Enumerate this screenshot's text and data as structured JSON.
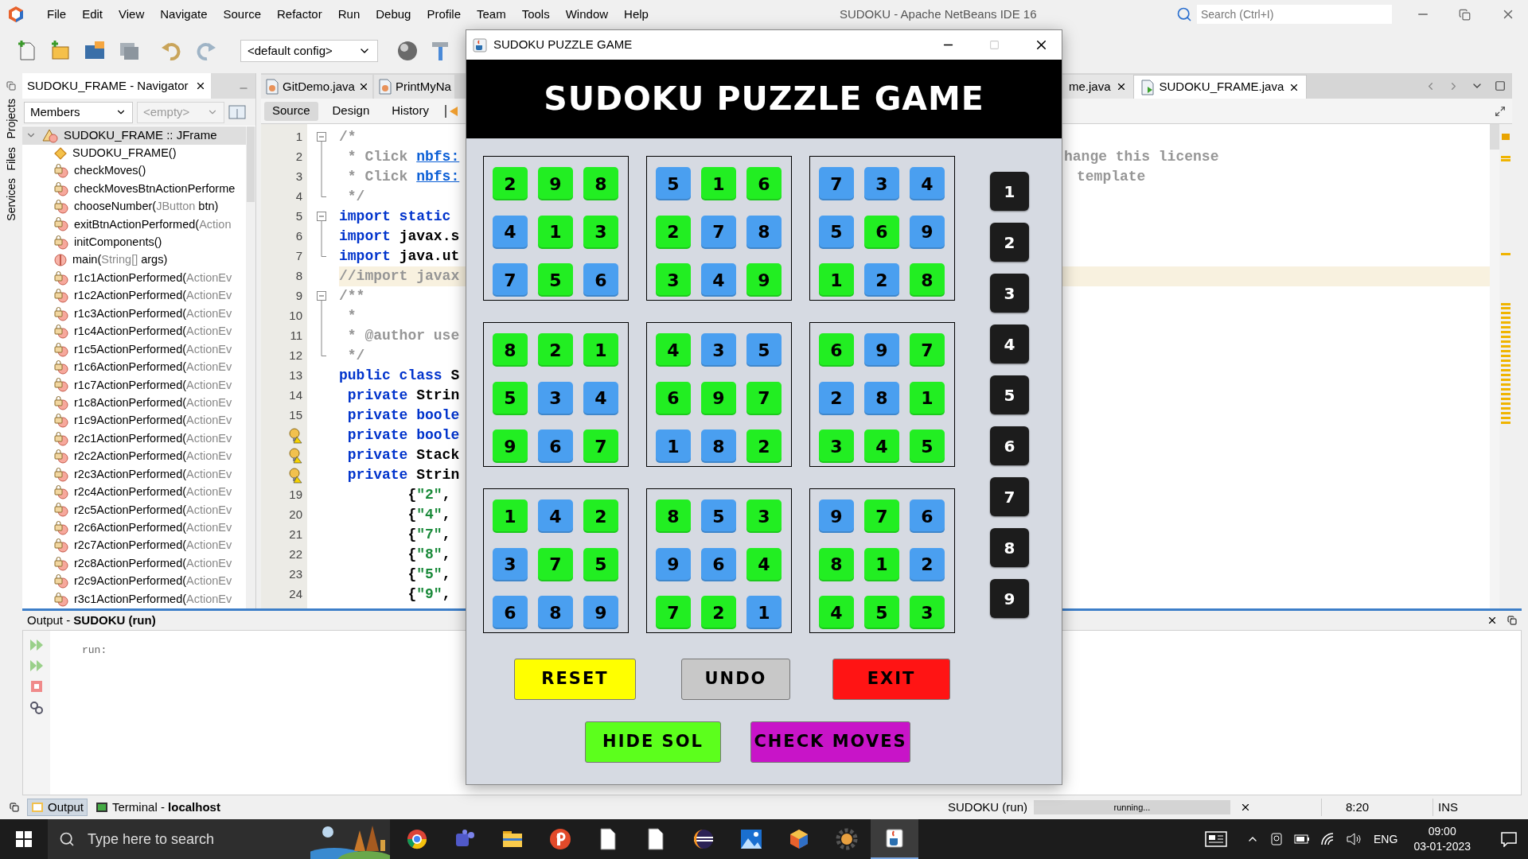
{
  "ide": {
    "title": "SUDOKU - Apache NetBeans IDE 16",
    "search": {
      "placeholder": "Search (Ctrl+I)"
    },
    "menu": [
      "File",
      "Edit",
      "View",
      "Navigate",
      "Source",
      "Refactor",
      "Run",
      "Debug",
      "Profile",
      "Team",
      "Tools",
      "Window",
      "Help"
    ],
    "config": "<default config>"
  },
  "side_tabs": [
    "Projects",
    "Files",
    "Services"
  ],
  "navigator": {
    "title": "SUDOKU_FRAME - Navigator",
    "filter": "Members",
    "filter_2": "<empty>",
    "root": {
      "label": "SUDOKU_FRAME :: JFrame",
      "expanded": true,
      "selected": true,
      "children": [
        {
          "kind": "constructor",
          "name": "SUDOKU_FRAME()",
          "selected": false
        },
        {
          "kind": "method",
          "name": "checkMoves()",
          "selected": false
        },
        {
          "kind": "method",
          "name": "checkMovesBtnActionPerforme",
          "selected": false
        },
        {
          "kind": "method",
          "name": "chooseNumber(",
          "param_type": "JButton",
          "rest": " btn)",
          "selected": false
        },
        {
          "kind": "method",
          "name": "exitBtnActionPerformed(",
          "param_type": "Action",
          "selected": false
        },
        {
          "kind": "method",
          "name": "initComponents()",
          "selected": false
        },
        {
          "kind": "static",
          "name": "main(",
          "param_type": "String[]",
          "rest": " args)",
          "selected": false
        },
        {
          "kind": "method",
          "name": "r1c1ActionPerformed(",
          "param_type": "ActionEv",
          "selected": false
        },
        {
          "kind": "method",
          "name": "r1c2ActionPerformed(",
          "param_type": "ActionEv",
          "selected": false
        },
        {
          "kind": "method",
          "name": "r1c3ActionPerformed(",
          "param_type": "ActionEv",
          "selected": false
        },
        {
          "kind": "method",
          "name": "r1c4ActionPerformed(",
          "param_type": "ActionEv",
          "selected": false
        },
        {
          "kind": "method",
          "name": "r1c5ActionPerformed(",
          "param_type": "ActionEv",
          "selected": false
        },
        {
          "kind": "method",
          "name": "r1c6ActionPerformed(",
          "param_type": "ActionEv",
          "selected": false
        },
        {
          "kind": "method",
          "name": "r1c7ActionPerformed(",
          "param_type": "ActionEv",
          "selected": false
        },
        {
          "kind": "method",
          "name": "r1c8ActionPerformed(",
          "param_type": "ActionEv",
          "selected": false
        },
        {
          "kind": "method",
          "name": "r1c9ActionPerformed(",
          "param_type": "ActionEv",
          "selected": false
        },
        {
          "kind": "method",
          "name": "r2c1ActionPerformed(",
          "param_type": "ActionEv",
          "selected": false
        },
        {
          "kind": "method",
          "name": "r2c2ActionPerformed(",
          "param_type": "ActionEv",
          "selected": false
        },
        {
          "kind": "method",
          "name": "r2c3ActionPerformed(",
          "param_type": "ActionEv",
          "selected": false
        },
        {
          "kind": "method",
          "name": "r2c4ActionPerformed(",
          "param_type": "ActionEv",
          "selected": false
        },
        {
          "kind": "method",
          "name": "r2c5ActionPerformed(",
          "param_type": "ActionEv",
          "selected": false
        },
        {
          "kind": "method",
          "name": "r2c6ActionPerformed(",
          "param_type": "ActionEv",
          "selected": false
        },
        {
          "kind": "method",
          "name": "r2c7ActionPerformed(",
          "param_type": "ActionEv",
          "selected": false
        },
        {
          "kind": "method",
          "name": "r2c8ActionPerformed(",
          "param_type": "ActionEv",
          "selected": false
        },
        {
          "kind": "method",
          "name": "r2c9ActionPerformed(",
          "param_type": "ActionEv",
          "selected": false
        },
        {
          "kind": "method",
          "name": "r3c1ActionPerformed(",
          "param_type": "ActionEv",
          "selected": false
        }
      ]
    }
  },
  "editor": {
    "tabs_left": [
      {
        "label": "GitDemo.java",
        "selected": false
      },
      {
        "label": "PrintMyNa",
        "selected": false
      }
    ],
    "tabs_right": [
      {
        "label": "me.java",
        "selected": false
      },
      {
        "label": "SUDOKU_FRAME.java",
        "selected": true
      }
    ],
    "views": [
      {
        "label": "Source",
        "selected": true
      },
      {
        "label": "Design",
        "selected": false
      },
      {
        "label": "History",
        "selected": false
      }
    ],
    "lines": [
      {
        "number": "1",
        "warning": false,
        "kind": "fold_start",
        "highlighted": false,
        "tokens": [
          {
            "kind": "comment",
            "text": "/*"
          }
        ]
      },
      {
        "number": "2",
        "warning": false,
        "kind": "fold_body",
        "highlighted": false,
        "tokens": [
          {
            "kind": "comment",
            "text": " * Click "
          },
          {
            "kind": "link",
            "text": "nbfs:"
          }
        ],
        "tail": "hange this license"
      },
      {
        "number": "3",
        "warning": false,
        "kind": "fold_body",
        "highlighted": false,
        "tokens": [
          {
            "kind": "comment",
            "text": " * Click "
          },
          {
            "kind": "link",
            "text": "nbfs:"
          }
        ],
        "tail": "template"
      },
      {
        "number": "4",
        "warning": false,
        "kind": "fold_end",
        "highlighted": false,
        "tokens": [
          {
            "kind": "comment",
            "text": " */"
          }
        ]
      },
      {
        "number": "5",
        "warning": false,
        "kind": "fold_start",
        "highlighted": false,
        "tokens": [
          {
            "kind": "keyword",
            "text": "import static"
          }
        ]
      },
      {
        "number": "6",
        "warning": false,
        "kind": "fold_body",
        "highlighted": false,
        "tokens": [
          {
            "kind": "keyword",
            "text": "import "
          },
          {
            "kind": "plain",
            "text": "javax.s"
          }
        ]
      },
      {
        "number": "7",
        "warning": false,
        "kind": "fold_end",
        "highlighted": false,
        "tokens": [
          {
            "kind": "keyword",
            "text": "import "
          },
          {
            "kind": "plain",
            "text": "java.ut"
          }
        ]
      },
      {
        "number": "8",
        "warning": false,
        "kind": "plain",
        "highlighted": true,
        "tokens": [
          {
            "kind": "comment",
            "text": "//import javax"
          }
        ]
      },
      {
        "number": "9",
        "warning": false,
        "kind": "fold_start",
        "highlighted": false,
        "tokens": [
          {
            "kind": "comment",
            "text": "/**"
          }
        ]
      },
      {
        "number": "10",
        "warning": false,
        "kind": "fold_body",
        "highlighted": false,
        "tokens": [
          {
            "kind": "comment",
            "text": " *"
          }
        ]
      },
      {
        "number": "11",
        "warning": false,
        "kind": "fold_body",
        "highlighted": false,
        "tokens": [
          {
            "kind": "comment",
            "text": " * @author use"
          }
        ]
      },
      {
        "number": "12",
        "warning": false,
        "kind": "fold_end",
        "highlighted": false,
        "tokens": [
          {
            "kind": "comment",
            "text": " */"
          }
        ]
      },
      {
        "number": "13",
        "warning": false,
        "kind": "plain",
        "highlighted": false,
        "tokens": [
          {
            "kind": "keyword",
            "text": "public class "
          },
          {
            "kind": "plain",
            "text": "S"
          }
        ]
      },
      {
        "number": "14",
        "warning": false,
        "kind": "plain",
        "highlighted": false,
        "tokens": [
          {
            "kind": "keyword",
            "text": " private "
          },
          {
            "kind": "plain",
            "text": "Strin"
          }
        ]
      },
      {
        "number": "15",
        "warning": false,
        "kind": "plain",
        "highlighted": false,
        "tokens": [
          {
            "kind": "keyword",
            "text": " private boole"
          }
        ]
      },
      {
        "warning": true,
        "kind": "plain",
        "highlighted": false,
        "tokens": [
          {
            "kind": "keyword",
            "text": " private boole"
          }
        ]
      },
      {
        "warning": true,
        "kind": "plain",
        "highlighted": false,
        "tokens": [
          {
            "kind": "keyword",
            "text": " private "
          },
          {
            "kind": "plain",
            "text": "Stack"
          }
        ]
      },
      {
        "warning": true,
        "kind": "plain",
        "highlighted": false,
        "tokens": [
          {
            "kind": "keyword",
            "text": " private "
          },
          {
            "kind": "plain",
            "text": "Strin"
          }
        ]
      },
      {
        "number": "19",
        "warning": false,
        "kind": "plain",
        "highlighted": false,
        "tokens": [
          {
            "kind": "plain",
            "text": "        {"
          },
          {
            "kind": "string",
            "text": "\"2\""
          },
          {
            "kind": "plain",
            "text": ","
          }
        ]
      },
      {
        "number": "20",
        "warning": false,
        "kind": "plain",
        "highlighted": false,
        "tokens": [
          {
            "kind": "plain",
            "text": "        {"
          },
          {
            "kind": "string",
            "text": "\"4\""
          },
          {
            "kind": "plain",
            "text": ","
          }
        ]
      },
      {
        "number": "21",
        "warning": false,
        "kind": "plain",
        "highlighted": false,
        "tokens": [
          {
            "kind": "plain",
            "text": "        {"
          },
          {
            "kind": "string",
            "text": "\"7\""
          },
          {
            "kind": "plain",
            "text": ","
          }
        ]
      },
      {
        "number": "22",
        "warning": false,
        "kind": "plain",
        "highlighted": false,
        "tokens": [
          {
            "kind": "plain",
            "text": "        {"
          },
          {
            "kind": "string",
            "text": "\"8\""
          },
          {
            "kind": "plain",
            "text": ","
          }
        ]
      },
      {
        "number": "23",
        "warning": false,
        "kind": "plain",
        "highlighted": false,
        "tokens": [
          {
            "kind": "plain",
            "text": "        {"
          },
          {
            "kind": "string",
            "text": "\"5\""
          },
          {
            "kind": "plain",
            "text": ","
          }
        ]
      },
      {
        "number": "24",
        "warning": false,
        "kind": "plain",
        "highlighted": false,
        "tokens": [
          {
            "kind": "plain",
            "text": "        {"
          },
          {
            "kind": "string",
            "text": "\"9\""
          },
          {
            "kind": "plain",
            "text": ","
          }
        ]
      }
    ]
  },
  "sudoku": {
    "window_title": "SUDOKU PUZZLE GAME",
    "heading": "SUDOKU PUZZLE GAME",
    "boxes": [
      {
        "cells": [
          {
            "value": "2",
            "color": "#22ee22"
          },
          {
            "value": "9",
            "color": "#22ee22"
          },
          {
            "value": "8",
            "color": "#22ee22"
          },
          {
            "value": "4",
            "color": "#4a9ff0"
          },
          {
            "value": "1",
            "color": "#22ee22"
          },
          {
            "value": "3",
            "color": "#22ee22"
          },
          {
            "value": "7",
            "color": "#4a9ff0"
          },
          {
            "value": "5",
            "color": "#22ee22"
          },
          {
            "value": "6",
            "color": "#4a9ff0"
          }
        ]
      },
      {
        "cells": [
          {
            "value": "5",
            "color": "#4a9ff0"
          },
          {
            "value": "1",
            "color": "#22ee22"
          },
          {
            "value": "6",
            "color": "#22ee22"
          },
          {
            "value": "2",
            "color": "#22ee22"
          },
          {
            "value": "7",
            "color": "#4a9ff0"
          },
          {
            "value": "8",
            "color": "#4a9ff0"
          },
          {
            "value": "3",
            "color": "#22ee22"
          },
          {
            "value": "4",
            "color": "#4a9ff0"
          },
          {
            "value": "9",
            "color": "#22ee22"
          }
        ]
      },
      {
        "cells": [
          {
            "value": "7",
            "color": "#4a9ff0"
          },
          {
            "value": "3",
            "color": "#4a9ff0"
          },
          {
            "value": "4",
            "color": "#4a9ff0"
          },
          {
            "value": "5",
            "color": "#4a9ff0"
          },
          {
            "value": "6",
            "color": "#22ee22"
          },
          {
            "value": "9",
            "color": "#4a9ff0"
          },
          {
            "value": "1",
            "color": "#22ee22"
          },
          {
            "value": "2",
            "color": "#4a9ff0"
          },
          {
            "value": "8",
            "color": "#22ee22"
          }
        ]
      },
      {
        "cells": [
          {
            "value": "8",
            "color": "#22ee22"
          },
          {
            "value": "2",
            "color": "#22ee22"
          },
          {
            "value": "1",
            "color": "#22ee22"
          },
          {
            "value": "5",
            "color": "#22ee22"
          },
          {
            "value": "3",
            "color": "#4a9ff0"
          },
          {
            "value": "4",
            "color": "#4a9ff0"
          },
          {
            "value": "9",
            "color": "#22ee22"
          },
          {
            "value": "6",
            "color": "#4a9ff0"
          },
          {
            "value": "7",
            "color": "#22ee22"
          }
        ]
      },
      {
        "cells": [
          {
            "value": "4",
            "color": "#22ee22"
          },
          {
            "value": "3",
            "color": "#4a9ff0"
          },
          {
            "value": "5",
            "color": "#4a9ff0"
          },
          {
            "value": "6",
            "color": "#22ee22"
          },
          {
            "value": "9",
            "color": "#22ee22"
          },
          {
            "value": "7",
            "color": "#22ee22"
          },
          {
            "value": "1",
            "color": "#4a9ff0"
          },
          {
            "value": "8",
            "color": "#4a9ff0"
          },
          {
            "value": "2",
            "color": "#22ee22"
          }
        ]
      },
      {
        "cells": [
          {
            "value": "6",
            "color": "#22ee22"
          },
          {
            "value": "9",
            "color": "#4a9ff0"
          },
          {
            "value": "7",
            "color": "#22ee22"
          },
          {
            "value": "2",
            "color": "#4a9ff0"
          },
          {
            "value": "8",
            "color": "#4a9ff0"
          },
          {
            "value": "1",
            "color": "#22ee22"
          },
          {
            "value": "3",
            "color": "#22ee22"
          },
          {
            "value": "4",
            "color": "#22ee22"
          },
          {
            "value": "5",
            "color": "#22ee22"
          }
        ]
      },
      {
        "cells": [
          {
            "value": "1",
            "color": "#22ee22"
          },
          {
            "value": "4",
            "color": "#4a9ff0"
          },
          {
            "value": "2",
            "color": "#22ee22"
          },
          {
            "value": "3",
            "color": "#4a9ff0"
          },
          {
            "value": "7",
            "color": "#22ee22"
          },
          {
            "value": "5",
            "color": "#22ee22"
          },
          {
            "value": "6",
            "color": "#4a9ff0"
          },
          {
            "value": "8",
            "color": "#4a9ff0"
          },
          {
            "value": "9",
            "color": "#4a9ff0"
          }
        ]
      },
      {
        "cells": [
          {
            "value": "8",
            "color": "#22ee22"
          },
          {
            "value": "5",
            "color": "#4a9ff0"
          },
          {
            "value": "3",
            "color": "#22ee22"
          },
          {
            "value": "9",
            "color": "#4a9ff0"
          },
          {
            "value": "6",
            "color": "#4a9ff0"
          },
          {
            "value": "4",
            "color": "#22ee22"
          },
          {
            "value": "7",
            "color": "#22ee22"
          },
          {
            "value": "2",
            "color": "#22ee22"
          },
          {
            "value": "1",
            "color": "#4a9ff0"
          }
        ]
      },
      {
        "cells": [
          {
            "value": "9",
            "color": "#4a9ff0"
          },
          {
            "value": "7",
            "color": "#22ee22"
          },
          {
            "value": "6",
            "color": "#4a9ff0"
          },
          {
            "value": "8",
            "color": "#22ee22"
          },
          {
            "value": "1",
            "color": "#22ee22"
          },
          {
            "value": "2",
            "color": "#4a9ff0"
          },
          {
            "value": "4",
            "color": "#22ee22"
          },
          {
            "value": "5",
            "color": "#22ee22"
          },
          {
            "value": "3",
            "color": "#22ee22"
          }
        ]
      }
    ],
    "number_pad": [
      "1",
      "2",
      "3",
      "4",
      "5",
      "6",
      "7",
      "8",
      "9"
    ],
    "button_rows": [
      [
        {
          "label": "RESET",
          "color": "#ffff00"
        },
        {
          "label": "UNDO",
          "color": "#c8c8c8"
        },
        {
          "label": "EXIT",
          "color": "#ff1414"
        }
      ],
      [
        {
          "label": "HIDE SOL",
          "color": "#5cff1c"
        },
        {
          "label": "CHECK MOVES",
          "color": "#c814c8"
        }
      ]
    ]
  },
  "output": {
    "title": "Output - ",
    "title_bold": "SUDOKU (run)",
    "text": "run:"
  },
  "status_bar": {
    "tabs": [
      {
        "label": "Output",
        "selected": true
      },
      {
        "label": "Terminal - ",
        "bold": "localhost",
        "selected": false
      }
    ],
    "task": "SUDOKU (run)",
    "progress": {
      "text": "running...",
      "level": 1
    },
    "position": "8:20",
    "mode": "INS"
  },
  "taskbar": {
    "search": {
      "placeholder": "Type here to search"
    },
    "language": "ENG",
    "time": "09:00",
    "date": "03-01-2023"
  }
}
